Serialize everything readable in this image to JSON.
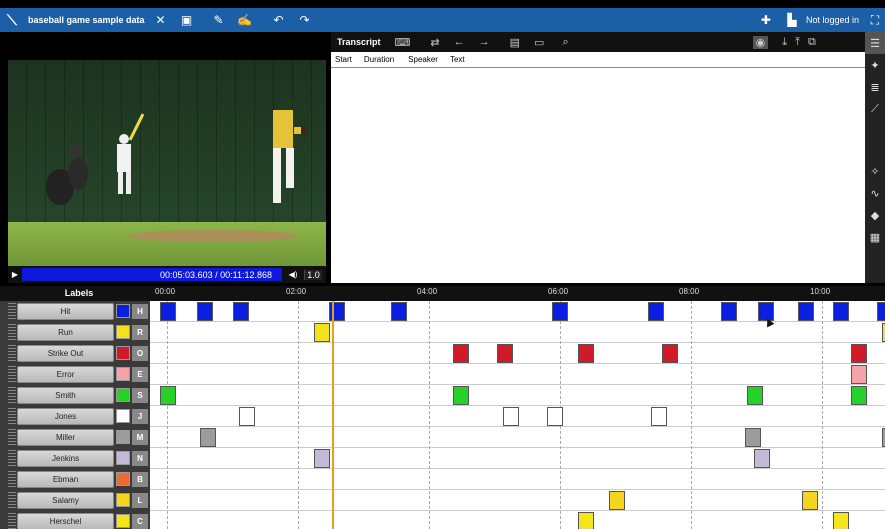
{
  "topbar": {
    "title": "baseball game sample data",
    "login": "Not logged in",
    "icons": [
      "app-logo-icon",
      "close-circle-icon",
      "save-icon",
      "pen-icon",
      "signature-icon",
      "undo-icon",
      "redo-icon",
      "add-icon",
      "user-icon",
      "expand-icon"
    ]
  },
  "video": {
    "time_current": "00:05:03.603",
    "time_total": "00:11:12.868",
    "speed": "1.0"
  },
  "transcript": {
    "title": "Transcript",
    "columns": [
      "Start",
      "Duration",
      "Speaker",
      "Text"
    ],
    "toolbar_icons": [
      "keyboard-icon",
      "repeat-icon",
      "arrow-left-icon",
      "arrow-right-icon",
      "comment-icon",
      "caption-icon",
      "search-icon",
      "eye-icon",
      "download-icon",
      "upload-icon",
      "copy-icon"
    ]
  },
  "rail_icons": [
    "list-icon",
    "puzzle-icon",
    "text-list-icon",
    "wand-icon",
    "sparkle-icon",
    "waveform-icon",
    "tag-icon",
    "film-icon"
  ],
  "timeline": {
    "header": "Labels",
    "ticks": [
      "00:00",
      "02:00",
      "04:00",
      "06:00",
      "08:00",
      "10:00"
    ],
    "labels": [
      {
        "name": "Hit",
        "key": "H",
        "color": "#0a1fe0"
      },
      {
        "name": "Run",
        "key": "R",
        "color": "#f3e21b"
      },
      {
        "name": "Strike Out",
        "key": "O",
        "color": "#d1192a"
      },
      {
        "name": "Error",
        "key": "E",
        "color": "#f4a3a8"
      },
      {
        "name": "Smith",
        "key": "S",
        "color": "#28d12a"
      },
      {
        "name": "Jones",
        "key": "J",
        "color": "#ffffff"
      },
      {
        "name": "Miller",
        "key": "M",
        "color": "#9c9c9c"
      },
      {
        "name": "Jenkins",
        "key": "N",
        "color": "#c4b9d6"
      },
      {
        "name": "Ebman",
        "key": "B",
        "color": "#ee6a33"
      },
      {
        "name": "Salamy",
        "key": "L",
        "color": "#f5d51e"
      },
      {
        "name": "Herschel",
        "key": "C",
        "color": "#f5e51b"
      }
    ],
    "playhead_time": "00:05:03.603"
  }
}
